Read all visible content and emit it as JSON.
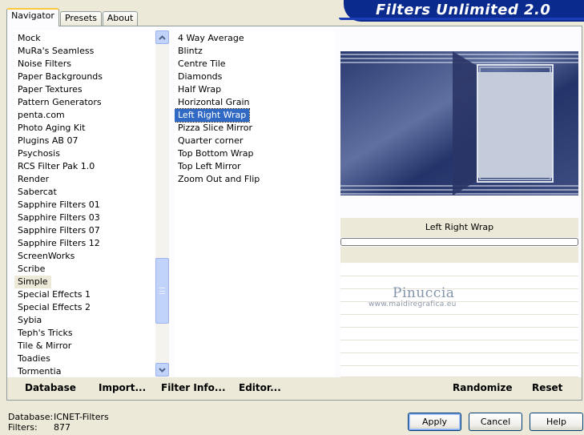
{
  "tabs": [
    "Navigator",
    "Presets",
    "About"
  ],
  "app_title": "Filters Unlimited 2.0",
  "categories": [
    "Mock",
    "MuRa's Seamless",
    "Noise Filters",
    "Paper Backgrounds",
    "Paper Textures",
    "Pattern Generators",
    "penta.com",
    "Photo Aging Kit",
    "Plugins AB 07",
    "Psychosis",
    "RCS Filter Pak 1.0",
    "Render",
    "Sabercat",
    "Sapphire Filters 01",
    "Sapphire Filters 03",
    "Sapphire Filters 07",
    "Sapphire Filters 12",
    "ScreenWorks",
    "Scribe",
    "Simple",
    "Special Effects 1",
    "Special Effects 2",
    "Sybia",
    "Teph's Tricks",
    "Tile & Mirror",
    "Toadies",
    "Tormentia"
  ],
  "selected_category": "Simple",
  "filters": [
    "4 Way Average",
    "Blintz",
    "Centre Tile",
    "Diamonds",
    "Half Wrap",
    "Horizontal Grain",
    "Left Right Wrap",
    "Pizza Slice Mirror",
    "Quarter corner",
    "Top Bottom Wrap",
    "Top Left Mirror",
    "Zoom Out and Flip"
  ],
  "selected_filter": "Left Right Wrap",
  "preview_label": "Left Right Wrap",
  "watermark": {
    "name": "Pinuccia",
    "url": "www.maidiregrafica.eu"
  },
  "bottom_actions": [
    "Database",
    "Import...",
    "Filter Info...",
    "Editor...",
    "Randomize",
    "Reset"
  ],
  "status": {
    "database_label": "Database:",
    "database_value": "ICNET-Filters",
    "filters_label": "Filters:",
    "filters_value": "877"
  },
  "buttons": {
    "apply": "Apply",
    "cancel": "Cancel",
    "help": "Help"
  }
}
